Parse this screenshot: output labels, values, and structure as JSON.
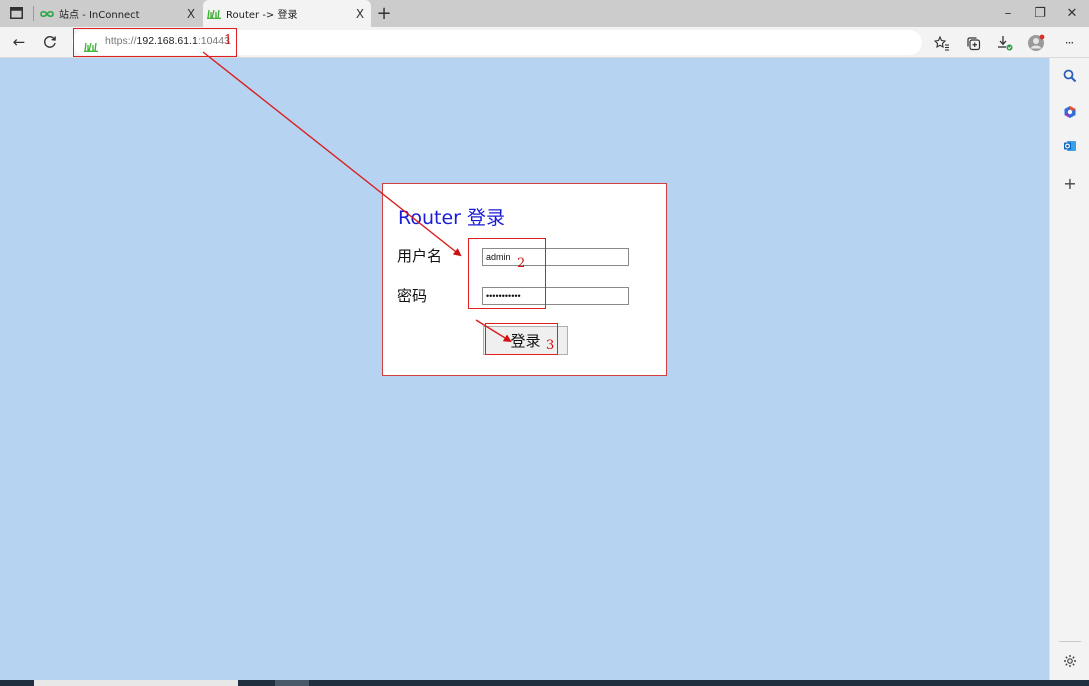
{
  "browser": {
    "tabs": [
      {
        "title": "站点 - InConnect",
        "close": "X"
      },
      {
        "title": "Router -> 登录",
        "close": "X"
      }
    ],
    "new_tab": "+",
    "window_controls": {
      "minimize": "–",
      "restore": "❐",
      "close": "✕"
    },
    "nav": {
      "back": "←",
      "reload": "C",
      "more": "···"
    },
    "url": {
      "scheme": "https://",
      "host": "192.168.61.1",
      "port": ":10443"
    }
  },
  "sidebar": {
    "add": "+"
  },
  "login": {
    "title": "Router 登录",
    "username_label": "用户名",
    "username_value": "admin",
    "password_label": "密码",
    "password_value": "•••••••••••",
    "submit_label": "登录"
  },
  "annotations": {
    "n1": "1",
    "n2": "2",
    "n3": "3",
    "color": "#e02020"
  },
  "colors": {
    "page_bg": "#b6d4f2",
    "title": "#1a1ad8",
    "tab_favicon": "#3cb034"
  }
}
